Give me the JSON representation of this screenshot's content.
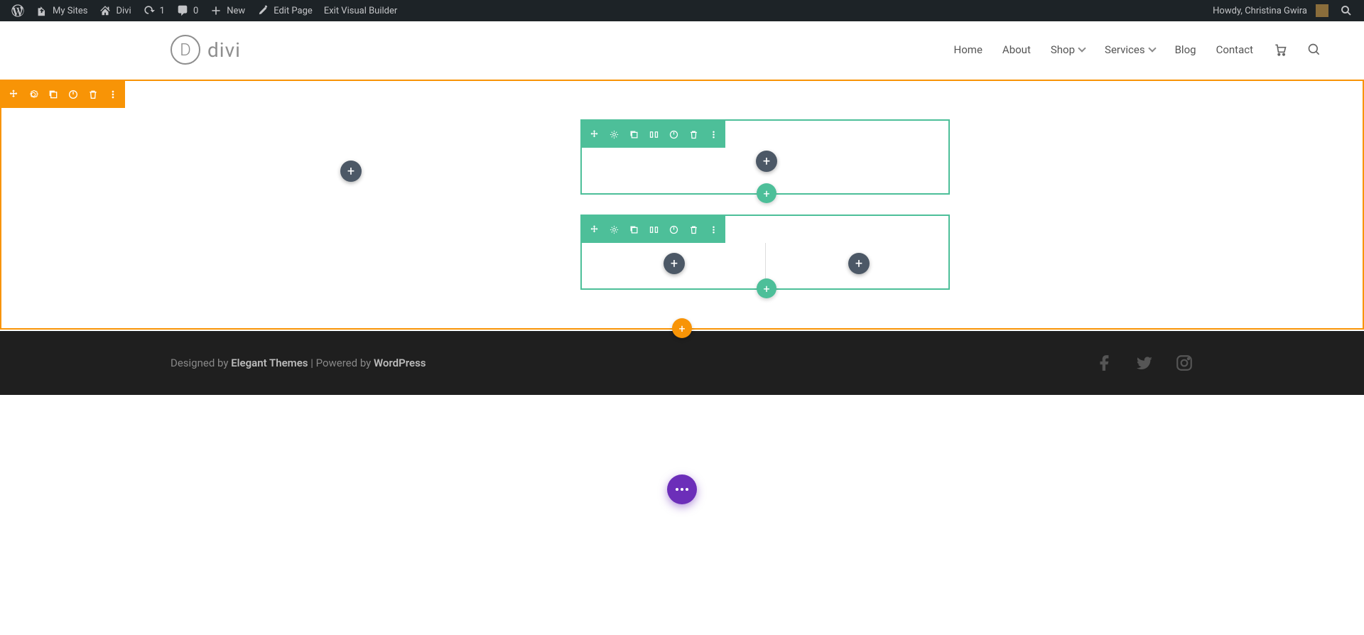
{
  "wpbar": {
    "mysites": "My Sites",
    "sitename": "Divi",
    "updates": "1",
    "comments": "0",
    "new": "New",
    "edit": "Edit Page",
    "exit": "Exit Visual Builder",
    "howdy": "Howdy, Christina Gwira"
  },
  "logo": {
    "d": "D",
    "text": "divi"
  },
  "nav": {
    "home": "Home",
    "about": "About",
    "shop": "Shop",
    "services": "Services",
    "blog": "Blog",
    "contact": "Contact"
  },
  "footer": {
    "designed": "Designed by ",
    "et": "Elegant Themes",
    "powered": " | Powered by ",
    "wp": "WordPress"
  }
}
